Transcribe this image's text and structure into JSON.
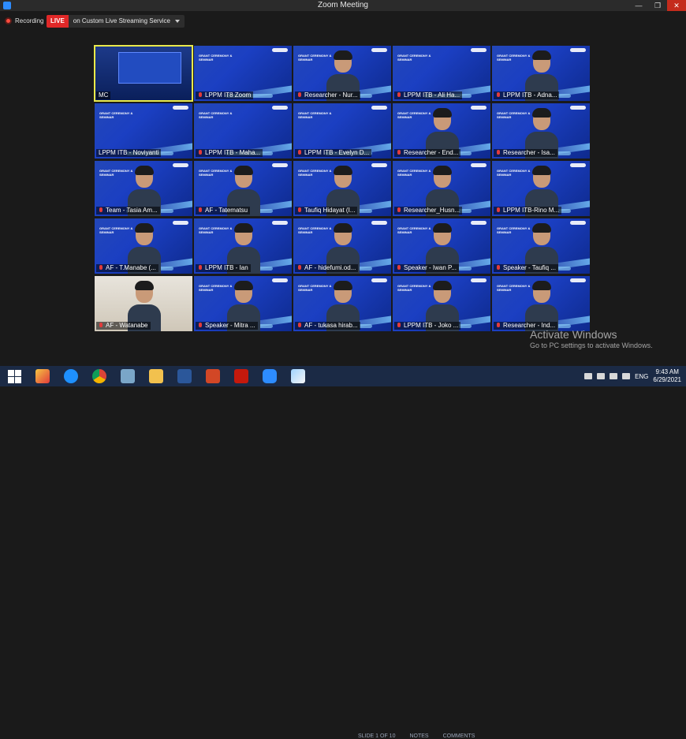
{
  "window": {
    "title": "Zoom Meeting"
  },
  "topbar": {
    "recording_label": "Recording",
    "live_badge": "LIVE",
    "live_service": "on Custom Live Streaming Service"
  },
  "slide": {
    "title_text": "GRANT CEREMONY & SEMINAR"
  },
  "participants": [
    {
      "name": "MC",
      "muted": false,
      "active": true
    },
    {
      "name": "LPPM IT8 Zoom",
      "muted": true
    },
    {
      "name": "Researcher - Nur...",
      "muted": true
    },
    {
      "name": "LPPM ITB - Ali Ha...",
      "muted": true
    },
    {
      "name": "LPPM ITB - Adna...",
      "muted": true
    },
    {
      "name": "LPPM ITB - Noviyanti",
      "muted": false
    },
    {
      "name": "LPPM ITB - Maha...",
      "muted": true
    },
    {
      "name": "LPPM ITB - Evelyn D...",
      "muted": true
    },
    {
      "name": "Researcher - End...",
      "muted": true
    },
    {
      "name": "Researcher - Isa...",
      "muted": true
    },
    {
      "name": "Team - Tasia Am...",
      "muted": true
    },
    {
      "name": "AF - Tatematsu",
      "muted": true
    },
    {
      "name": "Taufiq Hidayat (I...",
      "muted": true
    },
    {
      "name": "Researcher_Husn...",
      "muted": true
    },
    {
      "name": "LPPM ITB-Rino M...",
      "muted": true
    },
    {
      "name": "AF - T.Manabe (...",
      "muted": true
    },
    {
      "name": "LPPM ITB - Ian",
      "muted": true
    },
    {
      "name": "AF - hidefumi.od...",
      "muted": true
    },
    {
      "name": "Speaker - Iwan P...",
      "muted": true
    },
    {
      "name": "Speaker - Taufiq ...",
      "muted": true
    },
    {
      "name": "AF - Watanabe",
      "muted": true
    },
    {
      "name": "Speaker - Mitra ...",
      "muted": true
    },
    {
      "name": "AF - tukasa hirab...",
      "muted": true
    },
    {
      "name": "LPPM ITB - Joko ...",
      "muted": true
    },
    {
      "name": "Researcher - Ind...",
      "muted": true
    }
  ],
  "watermark": {
    "line1": "Activate Windows",
    "line2": "Go to PC settings to activate Windows."
  },
  "powerpoint_status": {
    "slide": "SLIDE 1 OF 10",
    "notes": "NOTES",
    "comments": "COMMENTS"
  },
  "taskbar": {
    "apps": [
      "windows-start",
      "paint-app",
      "internet-explorer",
      "chrome",
      "file-app",
      "file-explorer",
      "word",
      "powerpoint",
      "acrobat",
      "zoom",
      "paint-brush"
    ],
    "language": "ENG",
    "time": "9:43 AM",
    "date": "6/29/2021"
  }
}
